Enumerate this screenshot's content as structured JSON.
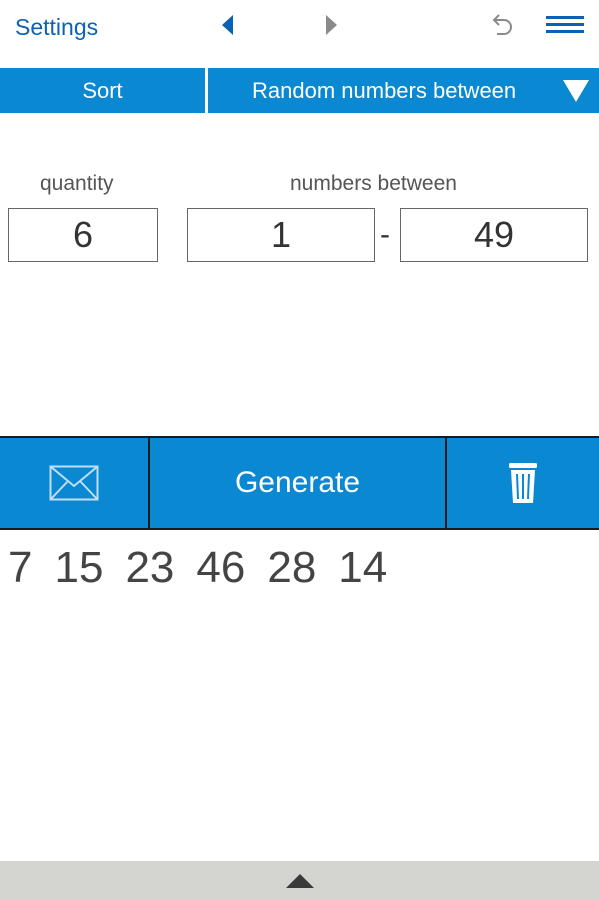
{
  "topbar": {
    "settings_label": "Settings",
    "prev_icon": "triangle-left-icon",
    "next_icon": "triangle-right-icon",
    "undo_icon": "undo-icon",
    "menu_icon": "hamburger-menu-icon"
  },
  "modebar": {
    "sort_label": "Sort",
    "mode_label": "Random numbers between",
    "caret_icon": "triangle-down-icon"
  },
  "form": {
    "quantity_label": "quantity",
    "between_label": "numbers between",
    "quantity_value": "6",
    "min_value": "1",
    "range_separator": "-",
    "max_value": "49"
  },
  "actions": {
    "mail_icon": "envelope-icon",
    "generate_label": "Generate",
    "trash_icon": "trash-can-icon"
  },
  "results": [
    "7",
    "15",
    "23",
    "46",
    "28",
    "14"
  ],
  "bottom": {
    "expand_icon": "triangle-up-icon"
  },
  "colors": {
    "accent_blue": "#0a88d2",
    "link_blue": "#0b62b4",
    "bottom_bar_gray": "#d4d4d0"
  }
}
